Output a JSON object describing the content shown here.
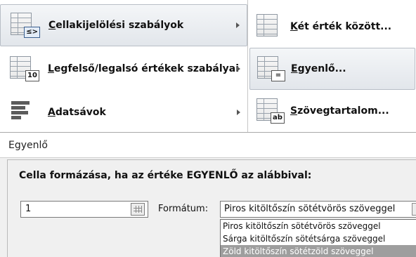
{
  "menu": {
    "items": [
      {
        "label": "Cellakijelölési szabályok",
        "icon": "highlight-cells-rules-icon",
        "badge": "≤>"
      },
      {
        "label": "Legfelső/legalsó értékek szabályai",
        "icon": "top-bottom-rules-icon",
        "badge": "10"
      },
      {
        "label": "Adatsávok",
        "icon": "data-bars-icon"
      }
    ],
    "submenu": [
      {
        "label": "Két érték között...",
        "icon": "between-icon"
      },
      {
        "label": "Egyenlő...",
        "icon": "equal-to-icon",
        "badge": "="
      },
      {
        "label": "Szövegtartalom...",
        "icon": "text-contains-icon",
        "badge": "ab"
      }
    ]
  },
  "dialog": {
    "title": "Egyenlő",
    "heading": "Cella formázása, ha az értéke EGYENLŐ az alábbival:",
    "value": "1",
    "format_label": "Formátum:",
    "format_selected": "Piros kitöltőszín sötétvörös szöveggel",
    "format_options": [
      "Piros kitöltőszín sötétvörös szöveggel",
      "Sárga kitöltőszín sötétsárga szöveggel",
      "Zöld kitöltőszín sötétzöld szöveggel"
    ],
    "highlighted_option_index": 2
  }
}
